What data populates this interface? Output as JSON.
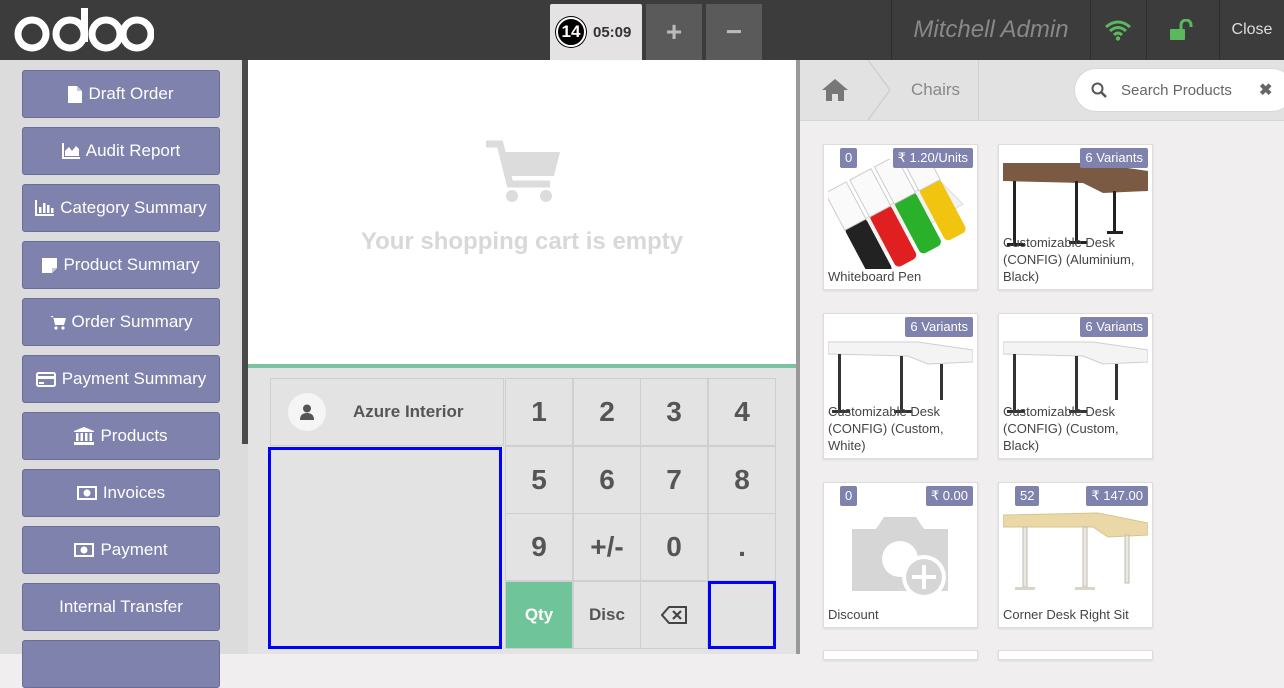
{
  "header": {
    "logo_text": "odoo",
    "order_number": "14",
    "order_time": "05:09",
    "add_label": "+",
    "remove_label": "−",
    "user_name": "Mitchell Admin",
    "close_label": "Close"
  },
  "sidebar": {
    "items": [
      {
        "label": "Draft Order",
        "icon": "file-icon"
      },
      {
        "label": "Audit Report",
        "icon": "area-chart-icon"
      },
      {
        "label": "Category Summary",
        "icon": "bar-chart-icon"
      },
      {
        "label": "Product Summary",
        "icon": "sticky-note-icon"
      },
      {
        "label": "Order Summary",
        "icon": "cart-icon"
      },
      {
        "label": "Payment Summary",
        "icon": "credit-card-icon"
      },
      {
        "label": "Products",
        "icon": "bank-icon"
      },
      {
        "label": "Invoices",
        "icon": "money-icon"
      },
      {
        "label": "Payment",
        "icon": "money-icon"
      },
      {
        "label": "Internal Transfer",
        "icon": ""
      }
    ]
  },
  "cart": {
    "empty_text": "Your shopping cart is empty"
  },
  "customer": {
    "name": "Azure Interior"
  },
  "numpad": {
    "keys": [
      "1",
      "2",
      "3",
      "4",
      "5",
      "6",
      "7",
      "8",
      "9",
      "+/-",
      "0",
      ".",
      "Qty",
      "Disc",
      "⌫",
      ""
    ]
  },
  "products_panel": {
    "breadcrumb": "Chairs",
    "search_placeholder": "Search Products",
    "clear_label": "✖",
    "items": [
      {
        "name": "Whiteboard Pen",
        "badge_left": "0",
        "badge_right": "₹ 1.20/Units"
      },
      {
        "name": "Customizable Desk (CONFIG) (Aluminium, Black)",
        "badge_left": "",
        "badge_right": "6 Variants"
      },
      {
        "name": "Customizable Desk (CONFIG) (Custom, White)",
        "badge_left": "",
        "badge_right": "6 Variants"
      },
      {
        "name": "Customizable Desk (CONFIG) (Custom, Black)",
        "badge_left": "",
        "badge_right": "6 Variants"
      },
      {
        "name": "Discount",
        "badge_left": "0",
        "badge_right": "₹ 0.00"
      },
      {
        "name": "Corner Desk Right Sit",
        "badge_left": "52",
        "badge_right": "₹ 147.00"
      }
    ]
  },
  "colors": {
    "header_bg": "#3c3c3c",
    "accent": "#7f82ac",
    "qty_green": "#70c499",
    "wifi_green": "#5cb85c"
  }
}
